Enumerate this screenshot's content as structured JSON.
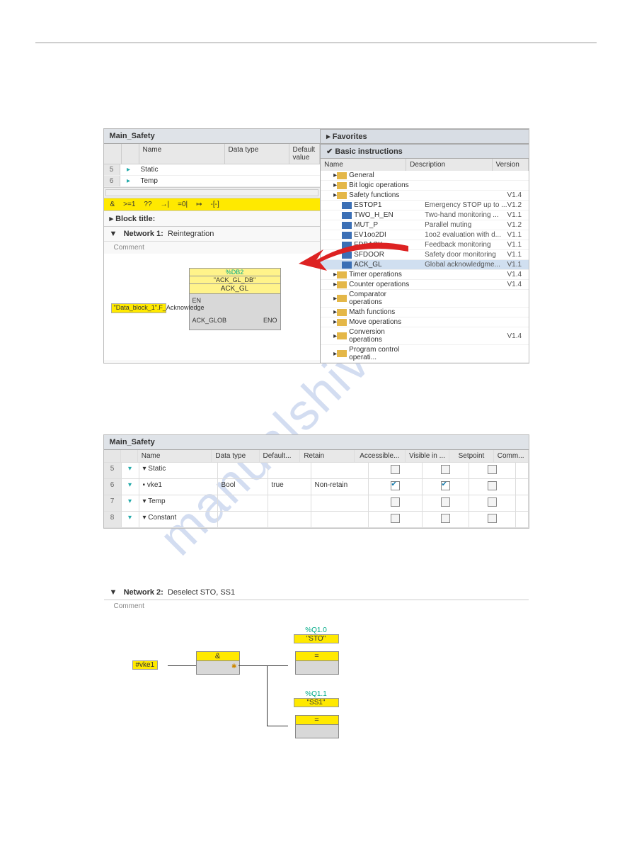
{
  "watermark": "manualshive.com",
  "shot1": {
    "title": "Main_Safety",
    "cols": {
      "name": "Name",
      "datatype": "Data type",
      "default": "Default value"
    },
    "rows": [
      {
        "num": "5",
        "name": "Static"
      },
      {
        "num": "6",
        "name": "Temp"
      }
    ],
    "toolbar": {
      "and": "&",
      "ge1": ">=1",
      "q": "??",
      "arrow1": "→|",
      "eq0": "=0|",
      "arrow2": "↦",
      "brk": "-[-]"
    },
    "blocktitle_label": "Block title:",
    "network_label": "Network 1:",
    "network_desc": "Reintegration",
    "comment_label": "Comment",
    "db_addr": "%DB2",
    "db_name": "\"ACK_GL_DB\"",
    "block_name": "ACK_GL",
    "pin_en": "EN",
    "pin_ack": "ACK_GLOB",
    "pin_eno": "ENO",
    "side_label": "\"Data_block_1\".F_Acknowledge",
    "favorites": "Favorites",
    "basic_instructions": "Basic instructions",
    "tree_cols": {
      "name": "Name",
      "desc": "Description",
      "ver": "Version"
    },
    "tree": [
      {
        "name": "General",
        "kind": "folder",
        "desc": "",
        "ver": ""
      },
      {
        "name": "Bit logic operations",
        "kind": "folder",
        "desc": "",
        "ver": ""
      },
      {
        "name": "Safety functions",
        "kind": "folder",
        "desc": "",
        "ver": "V1.4"
      },
      {
        "name": "ESTOP1",
        "kind": "fb",
        "desc": "Emergency STOP up to ...",
        "ver": "V1.2",
        "indent": 2
      },
      {
        "name": "TWO_H_EN",
        "kind": "fb",
        "desc": "Two-hand monitoring ...",
        "ver": "V1.1",
        "indent": 2
      },
      {
        "name": "MUT_P",
        "kind": "fb",
        "desc": "Parallel muting",
        "ver": "V1.2",
        "indent": 2
      },
      {
        "name": "EV1oo2DI",
        "kind": "fb",
        "desc": "1oo2 evaluation with d...",
        "ver": "V1.1",
        "indent": 2
      },
      {
        "name": "FDBACK",
        "kind": "fb",
        "desc": "Feedback monitoring",
        "ver": "V1.1",
        "indent": 2
      },
      {
        "name": "SFDOOR",
        "kind": "fb",
        "desc": "Safety door monitoring",
        "ver": "V1.1",
        "indent": 2
      },
      {
        "name": "ACK_GL",
        "kind": "fb",
        "desc": "Global acknowledgme...",
        "ver": "V1.1",
        "indent": 2,
        "sel": true
      },
      {
        "name": "Timer operations",
        "kind": "folder",
        "desc": "",
        "ver": "V1.4"
      },
      {
        "name": "Counter operations",
        "kind": "folder",
        "desc": "",
        "ver": "V1.4"
      },
      {
        "name": "Comparator operations",
        "kind": "folder",
        "desc": "",
        "ver": ""
      },
      {
        "name": "Math functions",
        "kind": "folder",
        "desc": "",
        "ver": ""
      },
      {
        "name": "Move operations",
        "kind": "folder",
        "desc": "",
        "ver": ""
      },
      {
        "name": "Conversion operations",
        "kind": "folder",
        "desc": "",
        "ver": "V1.4"
      },
      {
        "name": "Program control operati...",
        "kind": "folder",
        "desc": "",
        "ver": ""
      }
    ]
  },
  "shot2": {
    "title": "Main_Safety",
    "cols": {
      "name": "Name",
      "datatype": "Data type",
      "default": "Default...",
      "retain": "Retain",
      "accessible": "Accessible...",
      "visible": "Visible in ...",
      "setpoint": "Setpoint",
      "comment": "Comm..."
    },
    "rows": [
      {
        "num": "5",
        "name": "Static",
        "dt": "",
        "df": "",
        "rt": "",
        "ac": false,
        "vs": false,
        "sp": false
      },
      {
        "num": "6",
        "name": "vke1",
        "dt": "Bool",
        "df": "true",
        "rt": "Non-retain",
        "ac": true,
        "vs": true,
        "sp": false
      },
      {
        "num": "7",
        "name": "Temp",
        "dt": "",
        "df": "",
        "rt": "",
        "ac": false,
        "vs": false,
        "sp": false
      },
      {
        "num": "8",
        "name": "Constant",
        "dt": "",
        "df": "",
        "rt": "",
        "ac": false,
        "vs": false,
        "sp": false
      }
    ]
  },
  "shot3": {
    "network_label": "Network 2:",
    "network_desc": "Deselect STO, SS1",
    "comment_label": "Comment",
    "in_tag": "#vke1",
    "and_sym": "&",
    "eq_sym": "=",
    "out1_addr": "%Q1.0",
    "out1_name": "\"STO\"",
    "out2_addr": "%Q1.1",
    "out2_name": "\"SS1\""
  }
}
